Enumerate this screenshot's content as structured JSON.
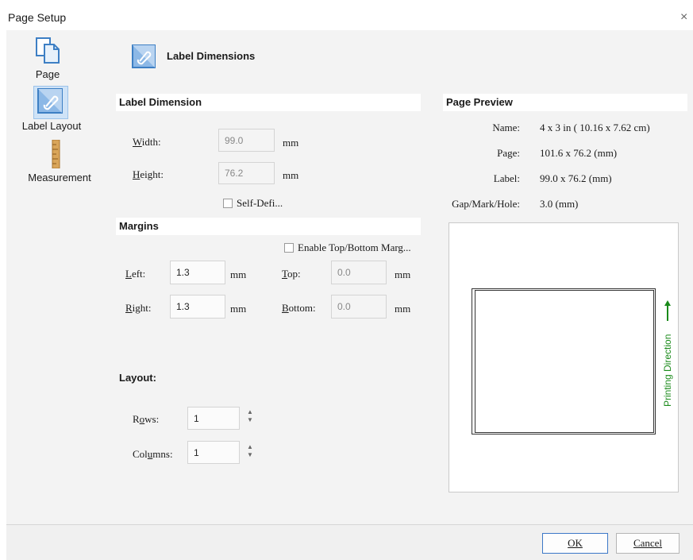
{
  "window": {
    "title": "Page Setup",
    "close_glyph": "×"
  },
  "sidebar": {
    "items": [
      {
        "label": "Page",
        "icon": "page-icon"
      },
      {
        "label": "Label Layout",
        "icon": "label-layout-icon"
      },
      {
        "label": "Measurement",
        "icon": "ruler-icon"
      }
    ]
  },
  "header": {
    "title": "Label Dimensions",
    "icon": "label-dimensions-icon"
  },
  "label_dimension": {
    "heading": "Label Dimension",
    "width": {
      "label": "Width:",
      "value": "99.0",
      "unit": "mm"
    },
    "height": {
      "label": "Height:",
      "value": "76.2",
      "unit": "mm"
    },
    "self_define": {
      "label": "Self-Defi...",
      "checked": false
    }
  },
  "margins": {
    "heading": "Margins",
    "enable_tb": {
      "label": "Enable Top/Bottom Marg...",
      "checked": false
    },
    "left": {
      "label": "Left:",
      "value": "1.3",
      "unit": "mm"
    },
    "right": {
      "label": "Right:",
      "value": "1.3",
      "unit": "mm"
    },
    "top": {
      "label": "Top:",
      "value": "0.0",
      "unit": "mm"
    },
    "bottom": {
      "label": "Bottom:",
      "value": "0.0",
      "unit": "mm"
    }
  },
  "layout": {
    "heading": "Layout:",
    "rows": {
      "label": "Rows:",
      "value": "1"
    },
    "columns": {
      "label": "Columns:",
      "value": "1"
    }
  },
  "page_preview": {
    "heading": "Page Preview",
    "name": {
      "label": "Name:",
      "value": "4 x 3 in ( 10.16 x 7.62 cm)"
    },
    "page": {
      "label": "Page:",
      "value": "101.6  x  76.2  (mm)"
    },
    "label": {
      "label": "Label:",
      "value": "99.0  x  76.2  (mm)"
    },
    "gap": {
      "label": "Gap/Mark/Hole:",
      "value": "3.0  (mm)"
    },
    "direction_text": "Printing Direction",
    "direction_color": "#1a8a1a"
  },
  "buttons": {
    "ok": "OK",
    "cancel": "Cancel"
  }
}
